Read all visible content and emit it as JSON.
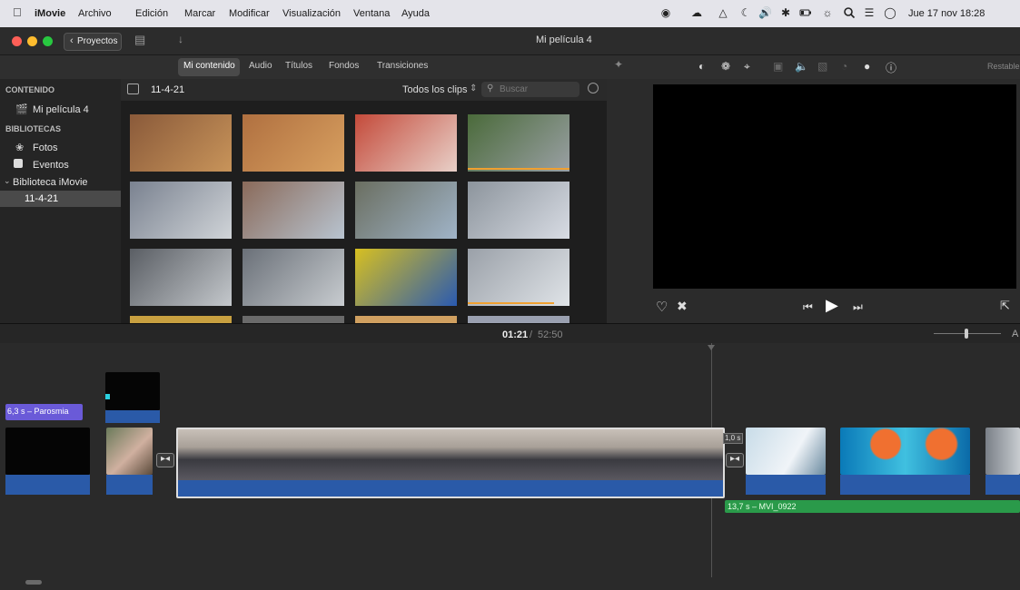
{
  "menubar": {
    "app": "iMovie",
    "items": [
      "Archivo",
      "Edición",
      "Marcar",
      "Modificar",
      "Visualización",
      "Ventana",
      "Ayuda"
    ],
    "datetime": "Jue 17 nov  18:28"
  },
  "titlebar": {
    "back_label": "Proyectos",
    "title": "Mi película 4"
  },
  "tabs": [
    "Mi contenido",
    "Audio",
    "Títulos",
    "Fondos",
    "Transiciones"
  ],
  "sidebar": {
    "content_header": "CONTENIDO",
    "project": "Mi película 4",
    "libraries_header": "BIBLIOTECAS",
    "items": [
      "Fotos",
      "Eventos"
    ],
    "library": "Biblioteca iMovie",
    "event": "11-4-21"
  },
  "browser": {
    "event_title": "11-4-21",
    "filter": "Todos los clips",
    "search_placeholder": "Buscar",
    "thumbs": [
      {
        "c1": "#8a5a3a",
        "c2": "#c8945a",
        "bar": 0.0
      },
      {
        "c1": "#b07040",
        "c2": "#d8a060",
        "bar": 0.0
      },
      {
        "c1": "#c44a3a",
        "c2": "#e8d0c8",
        "bar": 0.0
      },
      {
        "c1": "#4a6a3a",
        "c2": "#9aa0a4",
        "bar": 1.0
      },
      {
        "c1": "#7a8290",
        "c2": "#d0d4d8",
        "bar": 0.0
      },
      {
        "c1": "#8a6a5a",
        "c2": "#b8c4d0",
        "bar": 0.0
      },
      {
        "c1": "#6a6e60",
        "c2": "#a0b4c8",
        "bar": 0.0
      },
      {
        "c1": "#8c949c",
        "c2": "#d8dce4",
        "bar": 0.0
      },
      {
        "c1": "#5a5e64",
        "c2": "#c4c8cc",
        "bar": 0.0
      },
      {
        "c1": "#6a7078",
        "c2": "#c8ccd0",
        "bar": 0.0
      },
      {
        "c1": "#d8c020",
        "c2": "#2a5ab0",
        "bar": 0.0
      },
      {
        "c1": "#9aa0a8",
        "c2": "#e0e4e8",
        "bar": 0.85
      }
    ]
  },
  "viewer": {
    "reset_label": "Restable"
  },
  "timeline": {
    "current_time": "01:21",
    "total_time": "52:50",
    "title_clip": "6,3 s – Parosmia",
    "transition_dur": "1,0 s",
    "music_clip": "13,7 s – MVI_0922",
    "colors": {
      "audio": "#2a5aa8",
      "title": "#6a5ad8",
      "music": "#2a9a4a"
    }
  }
}
